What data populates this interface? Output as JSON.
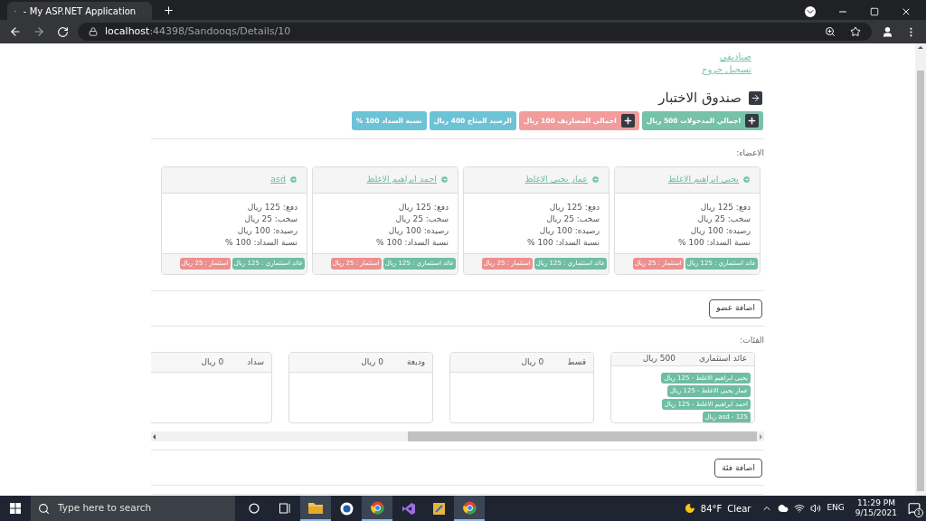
{
  "browser": {
    "tab_title": "- My ASP.NET Application",
    "url_host": "localhost",
    "url_path": ":44398/Sandooqs/Details/10"
  },
  "nav_links": [
    "صناديقي",
    "تسجيل خروج"
  ],
  "page_title": "صندوق الاختبار",
  "summary": [
    {
      "label": "اجمالي المدخولات 500 ريال",
      "color": "#76c2a8",
      "add_button": true
    },
    {
      "label": "اجمالي المصاريف 100 ريال",
      "color": "#f29c9c",
      "add_button": true
    },
    {
      "label": "الرصيد المتاح 400 ريال",
      "color": "#6cc3d6",
      "add_button": false
    },
    {
      "label": "نسبة السداد 100 %",
      "color": "#6cc3d6",
      "add_button": false
    }
  ],
  "members_label": "الاعضاء:",
  "members": [
    {
      "name": "يحيى ابراهيم الاغلط",
      "lines": [
        "دفع: 125 ريال",
        "سخب: 25 ريال",
        "رصيده: 100 ريال",
        "نسبة السداد: 100 %"
      ],
      "badges": [
        {
          "text": "عائد استثماري : 125 ريال",
          "color": "#6fbea3"
        },
        {
          "text": "استثمار : 25 ريال",
          "color": "#ee8f8f"
        }
      ]
    },
    {
      "name": "عمار يحيى الاغلط",
      "lines": [
        "دفع: 125 ريال",
        "سخب: 25 ريال",
        "رصيده: 100 ريال",
        "نسبة السداد: 100 %"
      ],
      "badges": [
        {
          "text": "عائد استثماري : 125 ريال",
          "color": "#6fbea3"
        },
        {
          "text": "استثمار : 25 ريال",
          "color": "#ee8f8f"
        }
      ]
    },
    {
      "name": "احمد ابراهيم الاغلط",
      "lines": [
        "دفع: 125 ريال",
        "سخب: 25 ريال",
        "رصيده: 100 ريال",
        "نسبة السداد: 100 %"
      ],
      "badges": [
        {
          "text": "عائد استثماري : 125 ريال",
          "color": "#6fbea3"
        },
        {
          "text": "استثمار : 25 ريال",
          "color": "#ee8f8f"
        }
      ]
    },
    {
      "name": "asd",
      "lines": [
        "دفع: 125 ريال",
        "سخب: 25 ريال",
        "رصيده: 100 ريال",
        "نسبة السداد: 100 %"
      ],
      "badges": [
        {
          "text": "عائد استثماري : 125 ريال",
          "color": "#6fbea3"
        },
        {
          "text": "استثمار : 25 ريال",
          "color": "#ee8f8f"
        }
      ]
    }
  ],
  "add_member": "اضافة عضو",
  "categories_label": "الفئات:",
  "categories": [
    {
      "name": "عائد استثماري",
      "amount": "500 ريال",
      "tags": [
        "يحيى ابراهيم الاغلط - 125 ريال",
        "عمار يحيى الاغلط - 125 ريال",
        "احمد ابراهيم الاغلط - 125 ريال",
        "asd - 125 ريال"
      ]
    },
    {
      "name": "قسط",
      "amount": "0 ريال"
    },
    {
      "name": "وديعة",
      "amount": "0 ريال"
    },
    {
      "name": "سداد",
      "amount": "0 ريال"
    }
  ],
  "add_category": "اضافة فئة",
  "taskbar": {
    "search_placeholder": "Type here to search",
    "temperature": "84°F",
    "condition": "Clear",
    "language": "ENG",
    "time": "11:29 PM",
    "date": "9/15/2021",
    "notifications": "1"
  }
}
